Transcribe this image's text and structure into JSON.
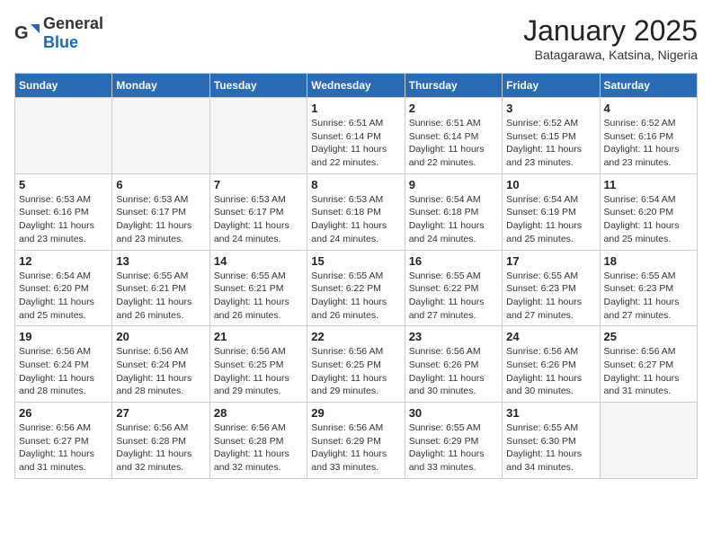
{
  "header": {
    "logo_general": "General",
    "logo_blue": "Blue",
    "title": "January 2025",
    "subtitle": "Batagarawa, Katsina, Nigeria"
  },
  "weekdays": [
    "Sunday",
    "Monday",
    "Tuesday",
    "Wednesday",
    "Thursday",
    "Friday",
    "Saturday"
  ],
  "weeks": [
    [
      {
        "day": "",
        "info": ""
      },
      {
        "day": "",
        "info": ""
      },
      {
        "day": "",
        "info": ""
      },
      {
        "day": "1",
        "info": "Sunrise: 6:51 AM\nSunset: 6:14 PM\nDaylight: 11 hours and 22 minutes."
      },
      {
        "day": "2",
        "info": "Sunrise: 6:51 AM\nSunset: 6:14 PM\nDaylight: 11 hours and 22 minutes."
      },
      {
        "day": "3",
        "info": "Sunrise: 6:52 AM\nSunset: 6:15 PM\nDaylight: 11 hours and 23 minutes."
      },
      {
        "day": "4",
        "info": "Sunrise: 6:52 AM\nSunset: 6:16 PM\nDaylight: 11 hours and 23 minutes."
      }
    ],
    [
      {
        "day": "5",
        "info": "Sunrise: 6:53 AM\nSunset: 6:16 PM\nDaylight: 11 hours and 23 minutes."
      },
      {
        "day": "6",
        "info": "Sunrise: 6:53 AM\nSunset: 6:17 PM\nDaylight: 11 hours and 23 minutes."
      },
      {
        "day": "7",
        "info": "Sunrise: 6:53 AM\nSunset: 6:17 PM\nDaylight: 11 hours and 24 minutes."
      },
      {
        "day": "8",
        "info": "Sunrise: 6:53 AM\nSunset: 6:18 PM\nDaylight: 11 hours and 24 minutes."
      },
      {
        "day": "9",
        "info": "Sunrise: 6:54 AM\nSunset: 6:18 PM\nDaylight: 11 hours and 24 minutes."
      },
      {
        "day": "10",
        "info": "Sunrise: 6:54 AM\nSunset: 6:19 PM\nDaylight: 11 hours and 25 minutes."
      },
      {
        "day": "11",
        "info": "Sunrise: 6:54 AM\nSunset: 6:20 PM\nDaylight: 11 hours and 25 minutes."
      }
    ],
    [
      {
        "day": "12",
        "info": "Sunrise: 6:54 AM\nSunset: 6:20 PM\nDaylight: 11 hours and 25 minutes."
      },
      {
        "day": "13",
        "info": "Sunrise: 6:55 AM\nSunset: 6:21 PM\nDaylight: 11 hours and 26 minutes."
      },
      {
        "day": "14",
        "info": "Sunrise: 6:55 AM\nSunset: 6:21 PM\nDaylight: 11 hours and 26 minutes."
      },
      {
        "day": "15",
        "info": "Sunrise: 6:55 AM\nSunset: 6:22 PM\nDaylight: 11 hours and 26 minutes."
      },
      {
        "day": "16",
        "info": "Sunrise: 6:55 AM\nSunset: 6:22 PM\nDaylight: 11 hours and 27 minutes."
      },
      {
        "day": "17",
        "info": "Sunrise: 6:55 AM\nSunset: 6:23 PM\nDaylight: 11 hours and 27 minutes."
      },
      {
        "day": "18",
        "info": "Sunrise: 6:55 AM\nSunset: 6:23 PM\nDaylight: 11 hours and 27 minutes."
      }
    ],
    [
      {
        "day": "19",
        "info": "Sunrise: 6:56 AM\nSunset: 6:24 PM\nDaylight: 11 hours and 28 minutes."
      },
      {
        "day": "20",
        "info": "Sunrise: 6:56 AM\nSunset: 6:24 PM\nDaylight: 11 hours and 28 minutes."
      },
      {
        "day": "21",
        "info": "Sunrise: 6:56 AM\nSunset: 6:25 PM\nDaylight: 11 hours and 29 minutes."
      },
      {
        "day": "22",
        "info": "Sunrise: 6:56 AM\nSunset: 6:25 PM\nDaylight: 11 hours and 29 minutes."
      },
      {
        "day": "23",
        "info": "Sunrise: 6:56 AM\nSunset: 6:26 PM\nDaylight: 11 hours and 30 minutes."
      },
      {
        "day": "24",
        "info": "Sunrise: 6:56 AM\nSunset: 6:26 PM\nDaylight: 11 hours and 30 minutes."
      },
      {
        "day": "25",
        "info": "Sunrise: 6:56 AM\nSunset: 6:27 PM\nDaylight: 11 hours and 31 minutes."
      }
    ],
    [
      {
        "day": "26",
        "info": "Sunrise: 6:56 AM\nSunset: 6:27 PM\nDaylight: 11 hours and 31 minutes."
      },
      {
        "day": "27",
        "info": "Sunrise: 6:56 AM\nSunset: 6:28 PM\nDaylight: 11 hours and 32 minutes."
      },
      {
        "day": "28",
        "info": "Sunrise: 6:56 AM\nSunset: 6:28 PM\nDaylight: 11 hours and 32 minutes."
      },
      {
        "day": "29",
        "info": "Sunrise: 6:56 AM\nSunset: 6:29 PM\nDaylight: 11 hours and 33 minutes."
      },
      {
        "day": "30",
        "info": "Sunrise: 6:55 AM\nSunset: 6:29 PM\nDaylight: 11 hours and 33 minutes."
      },
      {
        "day": "31",
        "info": "Sunrise: 6:55 AM\nSunset: 6:30 PM\nDaylight: 11 hours and 34 minutes."
      },
      {
        "day": "",
        "info": ""
      }
    ]
  ]
}
